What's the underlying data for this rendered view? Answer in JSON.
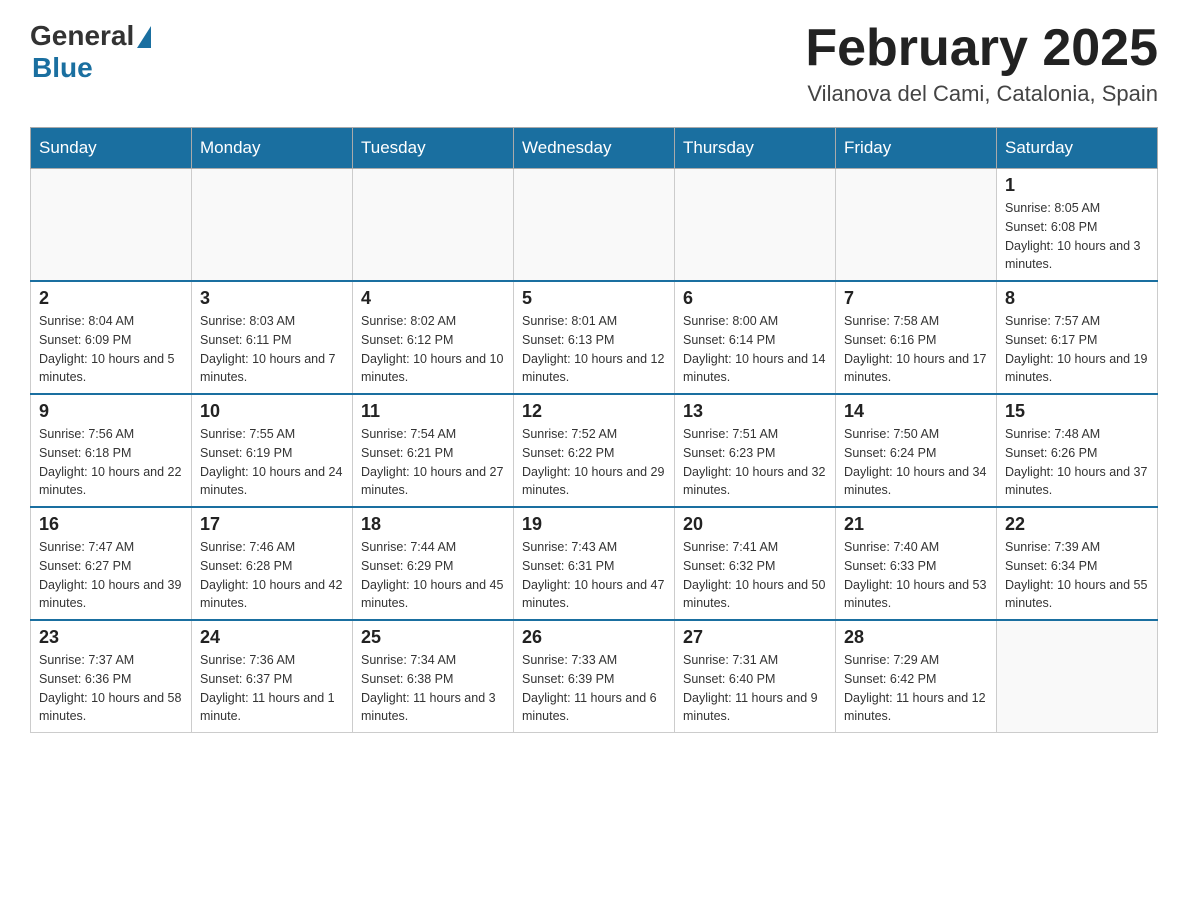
{
  "header": {
    "logo_general": "General",
    "logo_blue": "Blue",
    "month_title": "February 2025",
    "location": "Vilanova del Cami, Catalonia, Spain"
  },
  "weekdays": [
    "Sunday",
    "Monday",
    "Tuesday",
    "Wednesday",
    "Thursday",
    "Friday",
    "Saturday"
  ],
  "weeks": [
    [
      {
        "day": "",
        "info": ""
      },
      {
        "day": "",
        "info": ""
      },
      {
        "day": "",
        "info": ""
      },
      {
        "day": "",
        "info": ""
      },
      {
        "day": "",
        "info": ""
      },
      {
        "day": "",
        "info": ""
      },
      {
        "day": "1",
        "info": "Sunrise: 8:05 AM\nSunset: 6:08 PM\nDaylight: 10 hours and 3 minutes."
      }
    ],
    [
      {
        "day": "2",
        "info": "Sunrise: 8:04 AM\nSunset: 6:09 PM\nDaylight: 10 hours and 5 minutes."
      },
      {
        "day": "3",
        "info": "Sunrise: 8:03 AM\nSunset: 6:11 PM\nDaylight: 10 hours and 7 minutes."
      },
      {
        "day": "4",
        "info": "Sunrise: 8:02 AM\nSunset: 6:12 PM\nDaylight: 10 hours and 10 minutes."
      },
      {
        "day": "5",
        "info": "Sunrise: 8:01 AM\nSunset: 6:13 PM\nDaylight: 10 hours and 12 minutes."
      },
      {
        "day": "6",
        "info": "Sunrise: 8:00 AM\nSunset: 6:14 PM\nDaylight: 10 hours and 14 minutes."
      },
      {
        "day": "7",
        "info": "Sunrise: 7:58 AM\nSunset: 6:16 PM\nDaylight: 10 hours and 17 minutes."
      },
      {
        "day": "8",
        "info": "Sunrise: 7:57 AM\nSunset: 6:17 PM\nDaylight: 10 hours and 19 minutes."
      }
    ],
    [
      {
        "day": "9",
        "info": "Sunrise: 7:56 AM\nSunset: 6:18 PM\nDaylight: 10 hours and 22 minutes."
      },
      {
        "day": "10",
        "info": "Sunrise: 7:55 AM\nSunset: 6:19 PM\nDaylight: 10 hours and 24 minutes."
      },
      {
        "day": "11",
        "info": "Sunrise: 7:54 AM\nSunset: 6:21 PM\nDaylight: 10 hours and 27 minutes."
      },
      {
        "day": "12",
        "info": "Sunrise: 7:52 AM\nSunset: 6:22 PM\nDaylight: 10 hours and 29 minutes."
      },
      {
        "day": "13",
        "info": "Sunrise: 7:51 AM\nSunset: 6:23 PM\nDaylight: 10 hours and 32 minutes."
      },
      {
        "day": "14",
        "info": "Sunrise: 7:50 AM\nSunset: 6:24 PM\nDaylight: 10 hours and 34 minutes."
      },
      {
        "day": "15",
        "info": "Sunrise: 7:48 AM\nSunset: 6:26 PM\nDaylight: 10 hours and 37 minutes."
      }
    ],
    [
      {
        "day": "16",
        "info": "Sunrise: 7:47 AM\nSunset: 6:27 PM\nDaylight: 10 hours and 39 minutes."
      },
      {
        "day": "17",
        "info": "Sunrise: 7:46 AM\nSunset: 6:28 PM\nDaylight: 10 hours and 42 minutes."
      },
      {
        "day": "18",
        "info": "Sunrise: 7:44 AM\nSunset: 6:29 PM\nDaylight: 10 hours and 45 minutes."
      },
      {
        "day": "19",
        "info": "Sunrise: 7:43 AM\nSunset: 6:31 PM\nDaylight: 10 hours and 47 minutes."
      },
      {
        "day": "20",
        "info": "Sunrise: 7:41 AM\nSunset: 6:32 PM\nDaylight: 10 hours and 50 minutes."
      },
      {
        "day": "21",
        "info": "Sunrise: 7:40 AM\nSunset: 6:33 PM\nDaylight: 10 hours and 53 minutes."
      },
      {
        "day": "22",
        "info": "Sunrise: 7:39 AM\nSunset: 6:34 PM\nDaylight: 10 hours and 55 minutes."
      }
    ],
    [
      {
        "day": "23",
        "info": "Sunrise: 7:37 AM\nSunset: 6:36 PM\nDaylight: 10 hours and 58 minutes."
      },
      {
        "day": "24",
        "info": "Sunrise: 7:36 AM\nSunset: 6:37 PM\nDaylight: 11 hours and 1 minute."
      },
      {
        "day": "25",
        "info": "Sunrise: 7:34 AM\nSunset: 6:38 PM\nDaylight: 11 hours and 3 minutes."
      },
      {
        "day": "26",
        "info": "Sunrise: 7:33 AM\nSunset: 6:39 PM\nDaylight: 11 hours and 6 minutes."
      },
      {
        "day": "27",
        "info": "Sunrise: 7:31 AM\nSunset: 6:40 PM\nDaylight: 11 hours and 9 minutes."
      },
      {
        "day": "28",
        "info": "Sunrise: 7:29 AM\nSunset: 6:42 PM\nDaylight: 11 hours and 12 minutes."
      },
      {
        "day": "",
        "info": ""
      }
    ]
  ]
}
